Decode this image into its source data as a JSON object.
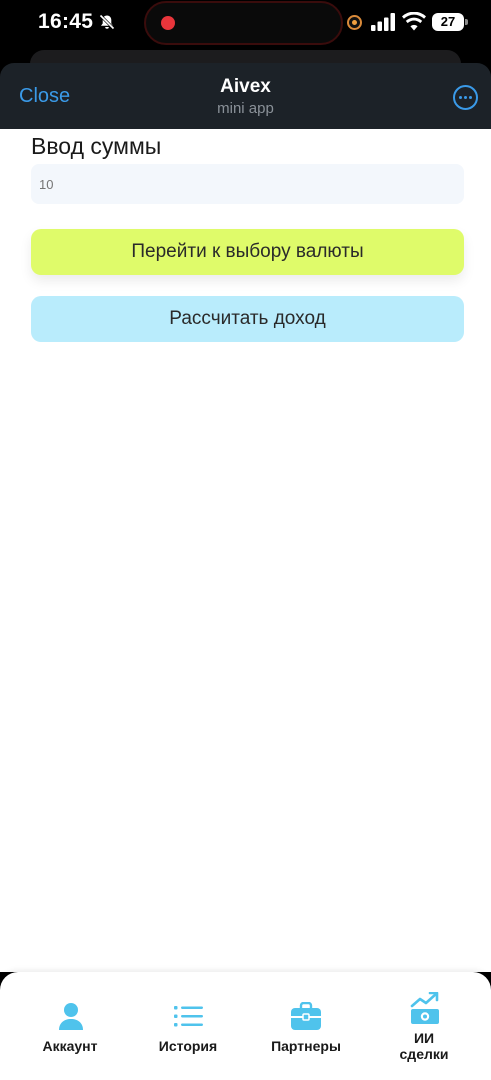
{
  "status_bar": {
    "time": "16:45",
    "battery": "27"
  },
  "header": {
    "close_label": "Close",
    "title": "Aivex",
    "subtitle": "mini app",
    "accent_color": "#3a9ae8"
  },
  "form": {
    "amount_label": "Ввод суммы",
    "amount_value": "",
    "amount_placeholder": "10",
    "currency_button_label": "Перейти к выбору валюты",
    "calculate_button_label": "Рассчитать доход",
    "currency_button_color": "#dffb6a",
    "calculate_button_color": "#b9ecfc"
  },
  "tabbar": {
    "icon_color": "#4fc3ec",
    "items": [
      {
        "label": "Аккаунт",
        "icon": "account-icon"
      },
      {
        "label": "История",
        "icon": "history-list-icon"
      },
      {
        "label": "Партнеры",
        "icon": "briefcase-icon"
      },
      {
        "label": "ИИ\nсделки",
        "icon": "money-chart-icon"
      }
    ]
  }
}
